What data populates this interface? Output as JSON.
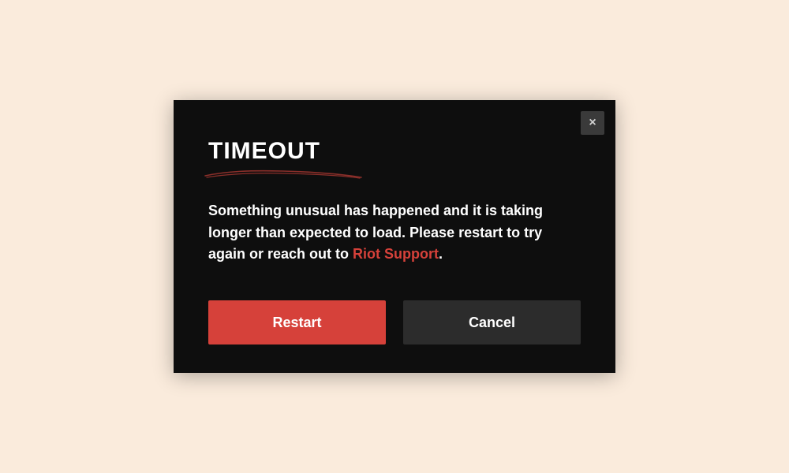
{
  "dialog": {
    "title": "TIMEOUT",
    "close_label": "×",
    "message_part1": "Something unusual has happened and it is taking longer than expected to load. Please restart to try again or reach out to ",
    "link_text": "Riot Support",
    "message_part2": ".",
    "restart_label": "Restart",
    "cancel_label": "Cancel"
  },
  "colors": {
    "background": "#faebdc",
    "dialog_bg": "#0e0e0e",
    "primary": "#d6413a",
    "secondary": "#2c2c2c",
    "close_bg": "#3a3a3a"
  }
}
